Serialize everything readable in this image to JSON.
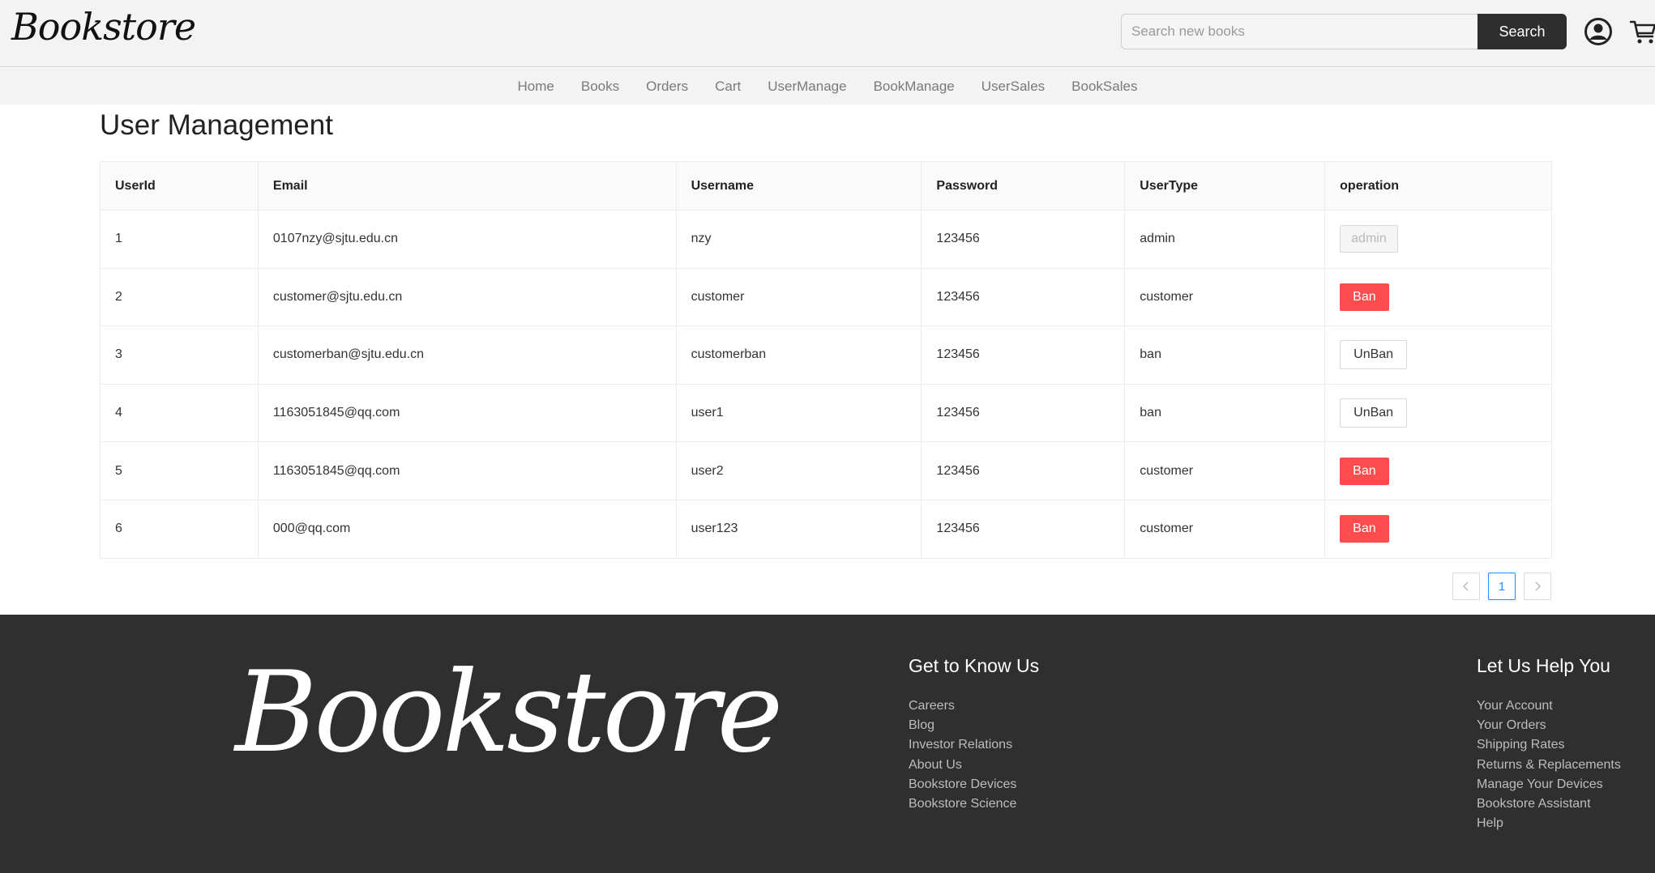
{
  "header": {
    "logo": "Bookstore",
    "search_placeholder": "Search new books",
    "search_label": "Search",
    "user_icon": "user-circle-icon",
    "cart_icon": "shopping-cart-icon"
  },
  "nav": [
    "Home",
    "Books",
    "Orders",
    "Cart",
    "UserManage",
    "BookManage",
    "UserSales",
    "BookSales"
  ],
  "page_title": "User Management",
  "table": {
    "columns": [
      "UserId",
      "Email",
      "Username",
      "Password",
      "UserType",
      "operation"
    ],
    "rows": [
      {
        "id": "1",
        "email": "0107nzy@sjtu.edu.cn",
        "username": "nzy",
        "password": "123456",
        "type": "admin",
        "action": "admin",
        "action_style": "disabled"
      },
      {
        "id": "2",
        "email": "customer@sjtu.edu.cn",
        "username": "customer",
        "password": "123456",
        "type": "customer",
        "action": "Ban",
        "action_style": "danger"
      },
      {
        "id": "3",
        "email": "customerban@sjtu.edu.cn",
        "username": "customerban",
        "password": "123456",
        "type": "ban",
        "action": "UnBan",
        "action_style": "default"
      },
      {
        "id": "4",
        "email": "1163051845@qq.com",
        "username": "user1",
        "password": "123456",
        "type": "ban",
        "action": "UnBan",
        "action_style": "default"
      },
      {
        "id": "5",
        "email": "1163051845@qq.com",
        "username": "user2",
        "password": "123456",
        "type": "customer",
        "action": "Ban",
        "action_style": "danger"
      },
      {
        "id": "6",
        "email": "000@qq.com",
        "username": "user123",
        "password": "123456",
        "type": "customer",
        "action": "Ban",
        "action_style": "danger"
      }
    ]
  },
  "pagination": {
    "current": "1",
    "prev_icon": "chevron-left-icon",
    "next_icon": "chevron-right-icon"
  },
  "footer": {
    "logo": "Bookstore",
    "col1": {
      "title": "Get to Know Us",
      "links": [
        "Careers",
        "Blog",
        "Investor Relations",
        "About Us",
        "Bookstore Devices",
        "Bookstore Science"
      ]
    },
    "col2": {
      "title": "Let Us Help You",
      "links": [
        "Your Account",
        "Your Orders",
        "Shipping Rates",
        "Returns & Replacements",
        "Manage Your Devices",
        "Bookstore Assistant",
        "Help"
      ]
    }
  },
  "colors": {
    "danger": "#ff4d4f",
    "dark": "#2f2f2f",
    "accent": "#1890ff"
  }
}
